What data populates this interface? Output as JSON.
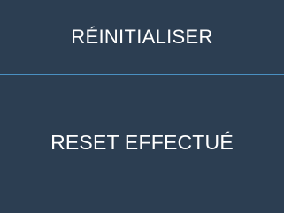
{
  "dialog": {
    "title": "RÉINITIALISER",
    "message": "RESET EFFECTUÉ"
  },
  "colors": {
    "background": "#2c3e52",
    "divider": "#4a90c2",
    "text": "#ffffff"
  }
}
